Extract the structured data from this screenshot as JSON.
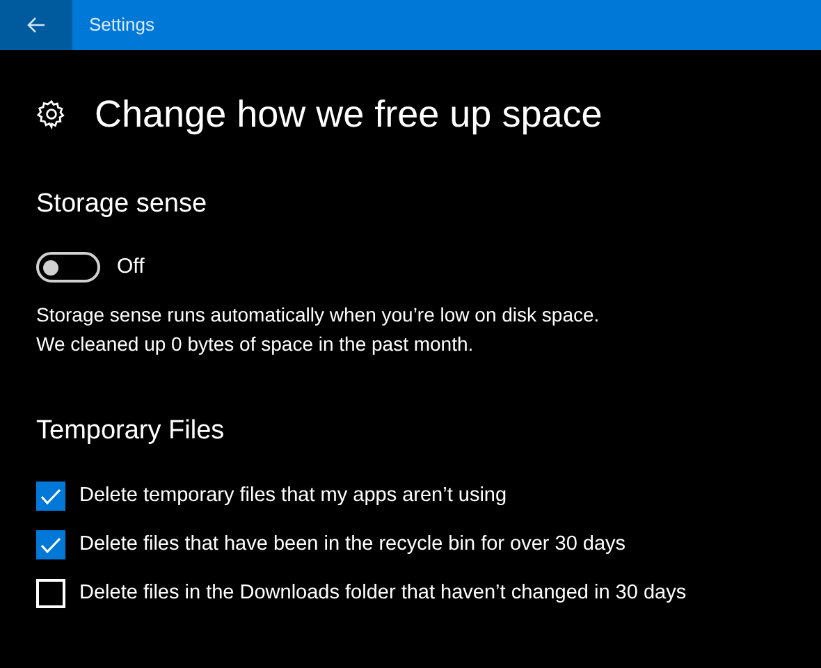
{
  "window": {
    "title": "Settings"
  },
  "page_title": "Change how we free up space",
  "storage_sense": {
    "heading": "Storage sense",
    "toggle": {
      "on": false,
      "label": "Off"
    },
    "description": [
      "Storage sense runs automatically when you’re low on disk space.",
      "We cleaned up 0 bytes of space in the past month."
    ]
  },
  "temporary_files": {
    "heading": "Temporary Files",
    "options": [
      {
        "label": "Delete temporary files that my apps aren’t using",
        "checked": true
      },
      {
        "label": "Delete files that have been in the recycle bin for over 30 days",
        "checked": true
      },
      {
        "label": "Delete files in the Downloads folder that haven’t changed in 30 days",
        "checked": false
      }
    ]
  }
}
